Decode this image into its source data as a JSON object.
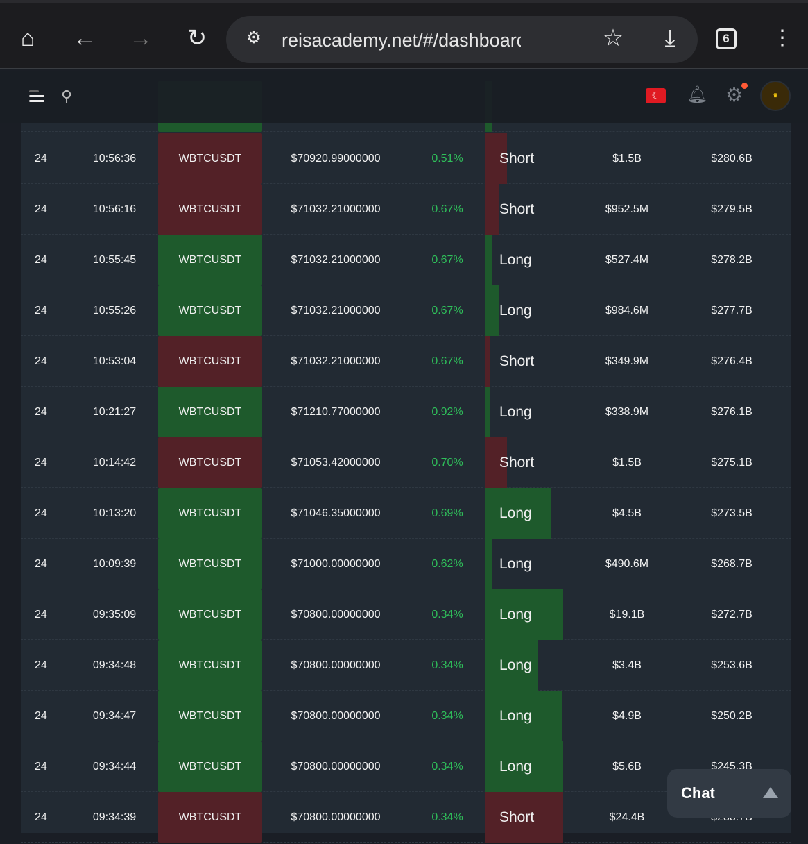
{
  "browser": {
    "url": "reisacademy.net/#/dashboard/sign",
    "tab_count": "6"
  },
  "colors": {
    "long": "#1e5a2c",
    "short": "#532127",
    "pct": "#2fbf5a",
    "bg": "#222a33"
  },
  "rows": [
    {
      "date": "24",
      "time": "10:56:36",
      "symbol": "WBTCUSDT",
      "price": "$70920.99000000",
      "pct": "0.51%",
      "side": "Short",
      "fill": 0.28,
      "amount": "$1.5B",
      "total": "$280.6B"
    },
    {
      "date": "24",
      "time": "10:56:16",
      "symbol": "WBTCUSDT",
      "price": "$71032.21000000",
      "pct": "0.67%",
      "side": "Short",
      "fill": 0.17,
      "amount": "$952.5M",
      "total": "$279.5B"
    },
    {
      "date": "24",
      "time": "10:55:45",
      "symbol": "WBTCUSDT",
      "price": "$71032.21000000",
      "pct": "0.67%",
      "side": "Long",
      "fill": 0.09,
      "amount": "$527.4M",
      "total": "$278.2B"
    },
    {
      "date": "24",
      "time": "10:55:26",
      "symbol": "WBTCUSDT",
      "price": "$71032.21000000",
      "pct": "0.67%",
      "side": "Long",
      "fill": 0.18,
      "amount": "$984.6M",
      "total": "$277.7B"
    },
    {
      "date": "24",
      "time": "10:53:04",
      "symbol": "WBTCUSDT",
      "price": "$71032.21000000",
      "pct": "0.67%",
      "side": "Short",
      "fill": 0.06,
      "amount": "$349.9M",
      "total": "$276.4B"
    },
    {
      "date": "24",
      "time": "10:21:27",
      "symbol": "WBTCUSDT",
      "price": "$71210.77000000",
      "pct": "0.92%",
      "side": "Long",
      "fill": 0.06,
      "amount": "$338.9M",
      "total": "$276.1B"
    },
    {
      "date": "24",
      "time": "10:14:42",
      "symbol": "WBTCUSDT",
      "price": "$71053.42000000",
      "pct": "0.70%",
      "side": "Short",
      "fill": 0.28,
      "amount": "$1.5B",
      "total": "$275.1B"
    },
    {
      "date": "24",
      "time": "10:13:20",
      "symbol": "WBTCUSDT",
      "price": "$71046.35000000",
      "pct": "0.69%",
      "side": "Long",
      "fill": 0.84,
      "amount": "$4.5B",
      "total": "$273.5B"
    },
    {
      "date": "24",
      "time": "10:09:39",
      "symbol": "WBTCUSDT",
      "price": "$71000.00000000",
      "pct": "0.62%",
      "side": "Long",
      "fill": 0.08,
      "amount": "$490.6M",
      "total": "$268.7B"
    },
    {
      "date": "24",
      "time": "09:35:09",
      "symbol": "WBTCUSDT",
      "price": "$70800.00000000",
      "pct": "0.34%",
      "side": "Long",
      "fill": 1.0,
      "amount": "$19.1B",
      "total": "$272.7B"
    },
    {
      "date": "24",
      "time": "09:34:48",
      "symbol": "WBTCUSDT",
      "price": "$70800.00000000",
      "pct": "0.34%",
      "side": "Long",
      "fill": 0.68,
      "amount": "$3.4B",
      "total": "$253.6B"
    },
    {
      "date": "24",
      "time": "09:34:47",
      "symbol": "WBTCUSDT",
      "price": "$70800.00000000",
      "pct": "0.34%",
      "side": "Long",
      "fill": 0.99,
      "amount": "$4.9B",
      "total": "$250.2B"
    },
    {
      "date": "24",
      "time": "09:34:44",
      "symbol": "WBTCUSDT",
      "price": "$70800.00000000",
      "pct": "0.34%",
      "side": "Long",
      "fill": 1.0,
      "amount": "$5.6B",
      "total": "$245.3B"
    },
    {
      "date": "24",
      "time": "09:34:39",
      "symbol": "WBTCUSDT",
      "price": "$70800.00000000",
      "pct": "0.34%",
      "side": "Short",
      "fill": 1.0,
      "amount": "$24.4B",
      "total": "$238.7B"
    }
  ],
  "chat": {
    "label": "Chat"
  }
}
